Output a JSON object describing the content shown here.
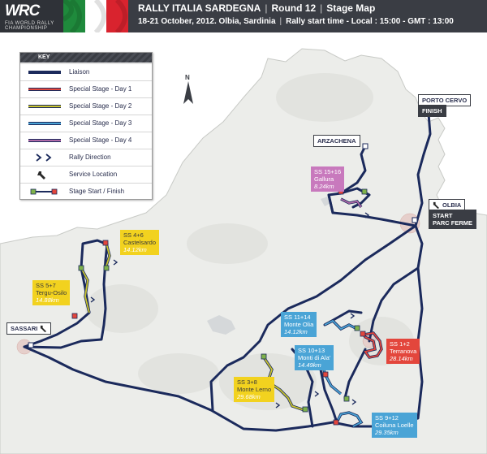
{
  "header": {
    "logo": "WRC",
    "logo_sub": "FIA WORLD RALLY CHAMPIONSHIP",
    "title": "RALLY ITALIA SARDEGNA",
    "round": "Round 12",
    "map_type": "Stage Map",
    "dates": "18-21 October, 2012. Olbia, Sardinia",
    "start_time": "Rally start time - Local : 15:00 - GMT : 13:00",
    "flag_colors": [
      "#1f8a3c",
      "#ffffff",
      "#d9232e"
    ]
  },
  "key": {
    "title": "KEY",
    "items": [
      {
        "label": "Liaison",
        "symbol": "liaison-line",
        "color": "#1b2a5c"
      },
      {
        "label": "Special Stage - Day 1",
        "symbol": "stage-line",
        "color": "#e3463c"
      },
      {
        "label": "Special Stage - Day 2",
        "symbol": "stage-line",
        "color": "#c8c32e"
      },
      {
        "label": "Special Stage - Day 3",
        "symbol": "stage-line",
        "color": "#4aa4d6"
      },
      {
        "label": "Special Stage - Day 4",
        "symbol": "stage-line",
        "color": "#b06aa8"
      },
      {
        "label": "Rally Direction",
        "symbol": "chevron-arrows-icon"
      },
      {
        "label": "Service Location",
        "symbol": "wrench-icon"
      },
      {
        "label": "Stage Start / Finish",
        "symbol": "start-finish-markers"
      }
    ]
  },
  "compass": {
    "label": "N"
  },
  "places": {
    "porto_cervo": {
      "name": "PORTO CERVO",
      "note": "FINISH"
    },
    "arzachena": {
      "name": "ARZACHENA"
    },
    "olbia": {
      "name": "OLBIA",
      "note1": "START",
      "note2": "PARC FERME"
    },
    "sassari": {
      "name": "SASSARI"
    }
  },
  "stages": [
    {
      "id": "SS 15+16",
      "name": "Gallura",
      "km": "8.24km",
      "day": 4
    },
    {
      "id": "SS 4+6",
      "name": "Castelsardo",
      "km": "14.12km",
      "day": 2
    },
    {
      "id": "SS 5+7",
      "name": "Tergu-Osilo",
      "km": "14.88km",
      "day": 2
    },
    {
      "id": "SS 11+14",
      "name": "Monte Olia",
      "km": "14.12km",
      "day": 3
    },
    {
      "id": "SS 1+2",
      "name": "Terranova",
      "km": "28.14km",
      "day": 1
    },
    {
      "id": "SS 10+13",
      "name": "Monti di Ala'",
      "km": "14.49km",
      "day": 3
    },
    {
      "id": "SS 3+8",
      "name": "Monte Lerno",
      "km": "29.68km",
      "day": 2
    },
    {
      "id": "SS 9+12",
      "name": "Coiluna Loelle",
      "km": "29.35km",
      "day": 3
    }
  ],
  "colors": {
    "land": "#ecedea",
    "sea": "#ffffff",
    "relief": "#e2e3df",
    "liaison": "#1b2a5c",
    "water": "#d5d8da",
    "town_area": "#e6cfcb"
  }
}
